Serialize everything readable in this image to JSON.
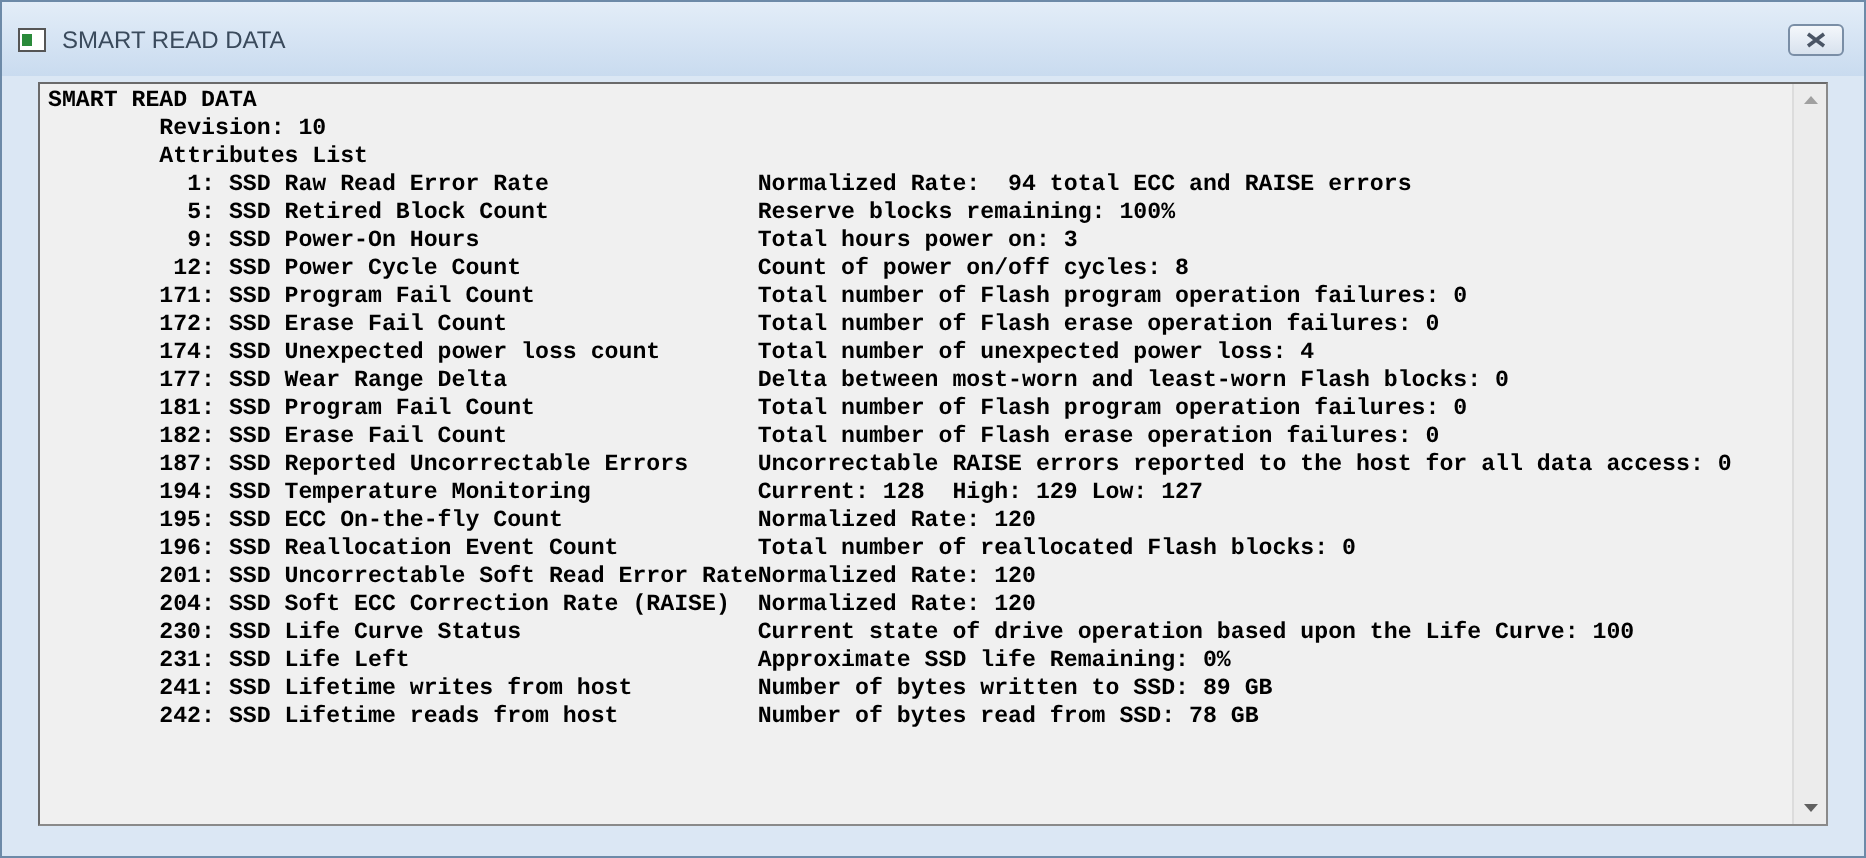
{
  "window": {
    "title": "SMART READ DATA"
  },
  "report": {
    "heading": "SMART READ DATA",
    "revision": "Revision: 10",
    "list_title": "Attributes List",
    "attributes": [
      {
        "id": "1:",
        "name": "SSD Raw Read Error Rate",
        "description": "Normalized Rate:  94 total ECC and RAISE errors"
      },
      {
        "id": "5:",
        "name": "SSD Retired Block Count",
        "description": "Reserve blocks remaining: 100%"
      },
      {
        "id": "9:",
        "name": "SSD Power-On Hours",
        "description": "Total hours power on: 3"
      },
      {
        "id": "12:",
        "name": "SSD Power Cycle Count",
        "description": "Count of power on/off cycles: 8"
      },
      {
        "id": "171:",
        "name": "SSD Program Fail Count",
        "description": "Total number of Flash program operation failures: 0"
      },
      {
        "id": "172:",
        "name": "SSD Erase Fail Count",
        "description": "Total number of Flash erase operation failures: 0"
      },
      {
        "id": "174:",
        "name": "SSD Unexpected power loss count",
        "description": "Total number of unexpected power loss: 4"
      },
      {
        "id": "177:",
        "name": "SSD Wear Range Delta",
        "description": "Delta between most-worn and least-worn Flash blocks: 0"
      },
      {
        "id": "181:",
        "name": "SSD Program Fail Count",
        "description": "Total number of Flash program operation failures: 0"
      },
      {
        "id": "182:",
        "name": "SSD Erase Fail Count",
        "description": "Total number of Flash erase operation failures: 0"
      },
      {
        "id": "187:",
        "name": "SSD Reported Uncorrectable Errors",
        "description": "Uncorrectable RAISE errors reported to the host for all data access: 0"
      },
      {
        "id": "194:",
        "name": "SSD Temperature Monitoring",
        "description": "Current: 128  High: 129 Low: 127"
      },
      {
        "id": "195:",
        "name": "SSD ECC On-the-fly Count",
        "description": "Normalized Rate: 120"
      },
      {
        "id": "196:",
        "name": "SSD Reallocation Event Count",
        "description": "Total number of reallocated Flash blocks: 0"
      },
      {
        "id": "201:",
        "name": "SSD Uncorrectable Soft Read Error Rate",
        "description": "Normalized Rate: 120"
      },
      {
        "id": "204:",
        "name": "SSD Soft ECC Correction Rate (RAISE)",
        "description": "Normalized Rate: 120"
      },
      {
        "id": "230:",
        "name": "SSD Life Curve Status",
        "description": "Current state of drive operation based upon the Life Curve: 100"
      },
      {
        "id": "231:",
        "name": "SSD Life Left",
        "description": "Approximate SSD life Remaining: 0%"
      },
      {
        "id": "241:",
        "name": "SSD Lifetime writes from host",
        "description": "Number of bytes written to SSD: 89 GB"
      },
      {
        "id": "242:",
        "name": "SSD Lifetime reads from host",
        "description": "Number of bytes read from SSD: 78 GB"
      }
    ]
  }
}
